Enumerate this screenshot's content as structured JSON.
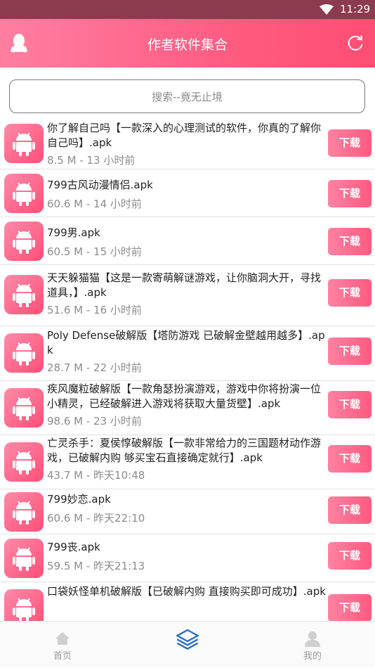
{
  "status_bar": {
    "time": "11:29"
  },
  "header": {
    "title": "作者软件集合"
  },
  "search": {
    "placeholder": "搜索--竟无止境"
  },
  "colors": {
    "accent": "#ff5c82",
    "status_bar": "#8c3a4e"
  },
  "download_label": "下载",
  "items": [
    {
      "name": "你了解自己吗【一款深入的心理测试的软件，你真的了解你自己吗】.apk",
      "meta": "8.5 M - 13 小时前"
    },
    {
      "name": "799古风动漫情侣.apk",
      "meta": "60.6 M - 14 小时前"
    },
    {
      "name": "799男.apk",
      "meta": "60.5 M - 15 小时前"
    },
    {
      "name": "天天躲猫猫【这是一款寄萌解谜游戏，让你脑洞大开，寻找道具，】.apk",
      "meta": "51.6 M - 16 小时前"
    },
    {
      "name": "Poly Defense破解版【塔防游戏 已破解金壁越用越多】.apk",
      "meta": "28.7 M - 22 小时前"
    },
    {
      "name": "疾风魔粒破解版【一款角瑟扮演游戏，游戏中你将扮演一位小精灵，已经破解进入游戏将获取大量货壁】.apk",
      "meta": "98.6 M - 23 小时前"
    },
    {
      "name": "亡灵杀手：夏侯惇破解版【一款非常给力的三国题材动作游戏，已破解内购 够买宝石直接确定就行】.apk",
      "meta": "43.7 M - 昨天10:48"
    },
    {
      "name": "799妙恋.apk",
      "meta": "60.6 M - 昨天22:10"
    },
    {
      "name": "799丧.apk",
      "meta": "59.5 M - 昨天21:13"
    },
    {
      "name": "口袋妖怪单机破解版【已破解内购 直接购买即可成功】.apk",
      "meta": ""
    }
  ],
  "nav": {
    "home": "首页",
    "files": "",
    "mine": "我的"
  }
}
